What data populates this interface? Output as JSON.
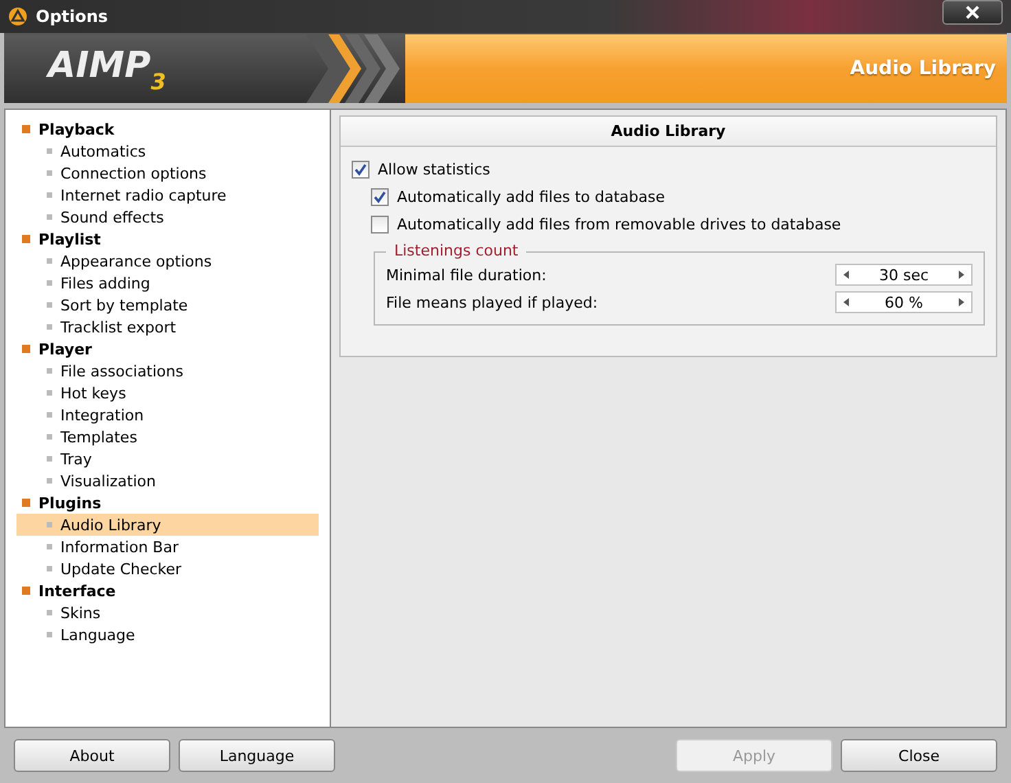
{
  "window": {
    "title": "Options"
  },
  "header": {
    "logo": "AIMP",
    "logo_suffix": "3",
    "section": "Audio Library"
  },
  "sidebar": {
    "items": [
      {
        "label": "Playback",
        "selected": false,
        "children": [
          {
            "label": "Automatics",
            "selected": false
          },
          {
            "label": "Connection options",
            "selected": false
          },
          {
            "label": "Internet radio capture",
            "selected": false
          },
          {
            "label": "Sound effects",
            "selected": false
          }
        ]
      },
      {
        "label": "Playlist",
        "selected": false,
        "children": [
          {
            "label": "Appearance options",
            "selected": false
          },
          {
            "label": "Files adding",
            "selected": false
          },
          {
            "label": "Sort by template",
            "selected": false
          },
          {
            "label": "Tracklist export",
            "selected": false
          }
        ]
      },
      {
        "label": "Player",
        "selected": false,
        "children": [
          {
            "label": "File associations",
            "selected": false
          },
          {
            "label": "Hot keys",
            "selected": false
          },
          {
            "label": "Integration",
            "selected": false
          },
          {
            "label": "Templates",
            "selected": false
          },
          {
            "label": "Tray",
            "selected": false
          },
          {
            "label": "Visualization",
            "selected": false
          }
        ]
      },
      {
        "label": "Plugins",
        "selected": false,
        "children": [
          {
            "label": "Audio Library",
            "selected": true
          },
          {
            "label": "Information Bar",
            "selected": false
          },
          {
            "label": "Update Checker",
            "selected": false
          }
        ]
      },
      {
        "label": "Interface",
        "selected": false,
        "children": [
          {
            "label": "Skins",
            "selected": false
          },
          {
            "label": "Language",
            "selected": false
          }
        ]
      }
    ]
  },
  "panel": {
    "title": "Audio Library",
    "options": [
      {
        "label": "Allow statistics",
        "checked": true,
        "children": [
          {
            "label": "Automatically add files to database",
            "checked": true
          },
          {
            "label": "Automatically add files from removable drives to database",
            "checked": false
          }
        ]
      }
    ],
    "group": {
      "title": "Listenings count",
      "fields": [
        {
          "label": "Minimal file duration:",
          "value": "30 sec"
        },
        {
          "label": "File means played if played:",
          "value": "60 %"
        }
      ]
    }
  },
  "buttons_left": [
    {
      "label": "About",
      "disabled": false
    },
    {
      "label": "Language",
      "disabled": false
    }
  ],
  "buttons_right": [
    {
      "label": "Apply",
      "disabled": true
    },
    {
      "label": "Close",
      "disabled": false
    }
  ]
}
